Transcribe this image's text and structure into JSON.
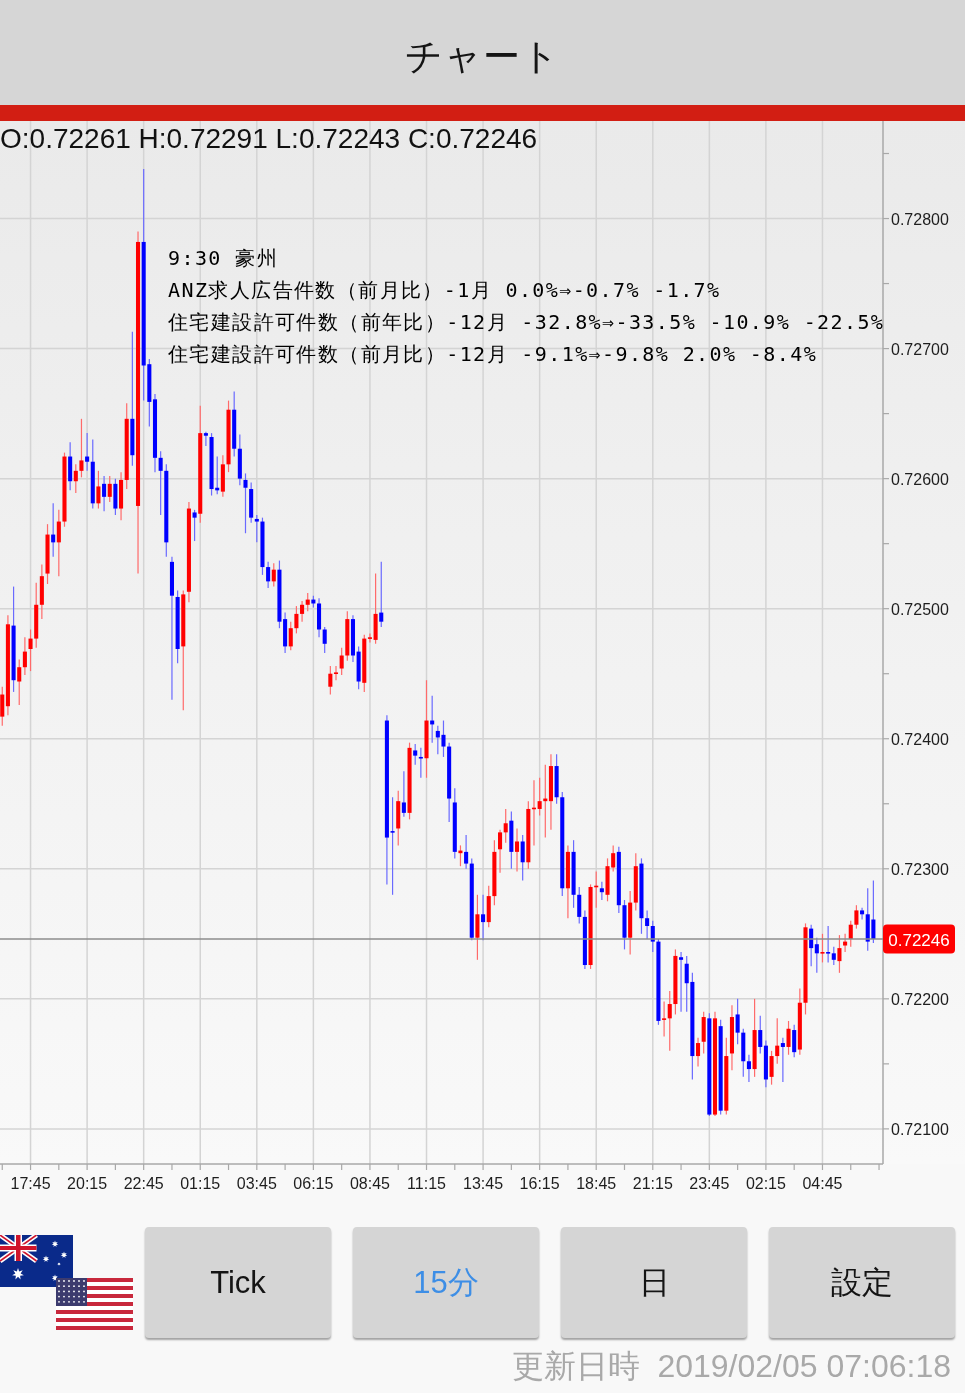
{
  "header": {
    "title": "チャート"
  },
  "chart": {
    "ohlc_readout": "O:0.72261 H:0.72291 L:0.72243 C:0.72246",
    "event_note": {
      "heading": "9:30 豪州",
      "lines": [
        "ANZ求人広告件数（前月比）-1月 0.0%⇒-0.7% -1.7%",
        "住宅建設許可件数（前年比）-12月 -32.8%⇒-33.5% -10.9% -22.5%",
        "住宅建設許可件数（前月比）-12月 -9.1%⇒-9.8% 2.0% -8.4%"
      ]
    },
    "chart_data": {
      "type": "candlestick",
      "grid": true,
      "categories": [
        null,
        null,
        null,
        null,
        null,
        "17:45",
        null,
        null,
        null,
        null,
        null,
        null,
        null,
        null,
        null,
        "20:15",
        null,
        null,
        null,
        null,
        null,
        null,
        null,
        null,
        null,
        "22:45",
        null,
        null,
        null,
        null,
        null,
        null,
        null,
        null,
        null,
        "01:15",
        null,
        null,
        null,
        null,
        null,
        null,
        null,
        null,
        null,
        "03:45",
        null,
        null,
        null,
        null,
        null,
        null,
        null,
        null,
        null,
        "06:15",
        null,
        null,
        null,
        null,
        null,
        null,
        null,
        null,
        null,
        "08:45",
        null,
        null,
        null,
        null,
        null,
        null,
        null,
        null,
        null,
        "11:15",
        null,
        null,
        null,
        null,
        null,
        null,
        null,
        null,
        null,
        "13:45",
        null,
        null,
        null,
        null,
        null,
        null,
        null,
        null,
        null,
        "16:15",
        null,
        null,
        null,
        null,
        null,
        null,
        null,
        null,
        null,
        "18:45",
        null,
        null,
        null,
        null,
        null,
        null,
        null,
        null,
        null,
        "21:15",
        null,
        null,
        null,
        null,
        null,
        null,
        null,
        null,
        null,
        "23:45",
        null,
        null,
        null,
        null,
        null,
        null,
        null,
        null,
        null,
        "02:15",
        null,
        null,
        null,
        null,
        null,
        null,
        null,
        null,
        null,
        "04:45",
        null,
        null,
        null,
        null,
        null,
        null,
        null,
        null,
        null
      ],
      "ohlc": [
        [
          0.72417,
          0.7244,
          0.7241,
          0.72434
        ],
        [
          0.72425,
          0.72495,
          0.72418,
          0.72488
        ],
        [
          0.72487,
          0.72517,
          0.72436,
          0.72445
        ],
        [
          0.72444,
          0.72461,
          0.72426,
          0.72455
        ],
        [
          0.72455,
          0.72478,
          0.72449,
          0.72467
        ],
        [
          0.72469,
          0.72484,
          0.72452,
          0.72477
        ],
        [
          0.72477,
          0.7252,
          0.7247,
          0.72503
        ],
        [
          0.72503,
          0.72534,
          0.72492,
          0.72525
        ],
        [
          0.72527,
          0.72565,
          0.72519,
          0.72557
        ],
        [
          0.72557,
          0.72581,
          0.7254,
          0.72551
        ],
        [
          0.72551,
          0.72576,
          0.72525,
          0.72567
        ],
        [
          0.72567,
          0.7262,
          0.72563,
          0.72617
        ],
        [
          0.72617,
          0.72628,
          0.72591,
          0.72598
        ],
        [
          0.72598,
          0.72611,
          0.72589,
          0.72606
        ],
        [
          0.72606,
          0.72646,
          0.72601,
          0.72614
        ],
        [
          0.72617,
          0.72635,
          0.72606,
          0.72613
        ],
        [
          0.72613,
          0.7263,
          0.72577,
          0.72581
        ],
        [
          0.72581,
          0.72606,
          0.72577,
          0.72594
        ],
        [
          0.72596,
          0.72602,
          0.72575,
          0.72586
        ],
        [
          0.72586,
          0.72602,
          0.72582,
          0.72596
        ],
        [
          0.72596,
          0.726,
          0.72572,
          0.72577
        ],
        [
          0.72577,
          0.72605,
          0.72568,
          0.72599
        ],
        [
          0.72599,
          0.72658,
          0.72592,
          0.72646
        ],
        [
          0.72646,
          0.72713,
          0.7261,
          0.72618
        ],
        [
          0.72579,
          0.7279,
          0.72527,
          0.72782
        ],
        [
          0.72782,
          0.72838,
          0.7266,
          0.72687
        ],
        [
          0.72688,
          0.72692,
          0.7264,
          0.72659
        ],
        [
          0.72661,
          0.72665,
          0.72605,
          0.72616
        ],
        [
          0.72616,
          0.72621,
          0.72572,
          0.72606
        ],
        [
          0.72606,
          0.72611,
          0.7254,
          0.72551
        ],
        [
          0.72536,
          0.7254,
          0.7243,
          0.7251
        ],
        [
          0.72509,
          0.72514,
          0.72458,
          0.72469
        ],
        [
          0.72471,
          0.72514,
          0.72422,
          0.72511
        ],
        [
          0.72513,
          0.72582,
          0.72505,
          0.72577
        ],
        [
          0.72574,
          0.72576,
          0.72552,
          0.7257
        ],
        [
          0.72573,
          0.72656,
          0.72566,
          0.72635
        ],
        [
          0.72635,
          0.72636,
          0.72625,
          0.72633
        ],
        [
          0.72632,
          0.72635,
          0.72587,
          0.72592
        ],
        [
          0.72593,
          0.72617,
          0.72588,
          0.72591
        ],
        [
          0.7259,
          0.72618,
          0.72586,
          0.72611
        ],
        [
          0.72611,
          0.7266,
          0.72605,
          0.72653
        ],
        [
          0.72653,
          0.72667,
          0.72617,
          0.72623
        ],
        [
          0.72623,
          0.72634,
          0.72595,
          0.726
        ],
        [
          0.72599,
          0.72604,
          0.72558,
          0.72593
        ],
        [
          0.72592,
          0.72597,
          0.72566,
          0.7257
        ],
        [
          0.72569,
          0.72572,
          0.72551,
          0.72567
        ],
        [
          0.72567,
          0.7257,
          0.72526,
          0.72532
        ],
        [
          0.72532,
          0.72536,
          0.72516,
          0.72521
        ],
        [
          0.72521,
          0.72535,
          0.72517,
          0.7253
        ],
        [
          0.7253,
          0.72537,
          0.72485,
          0.7249
        ],
        [
          0.72492,
          0.72497,
          0.72466,
          0.72471
        ],
        [
          0.72471,
          0.7249,
          0.72468,
          0.72485
        ],
        [
          0.72485,
          0.72502,
          0.72481,
          0.72496
        ],
        [
          0.72496,
          0.72506,
          0.7249,
          0.72503
        ],
        [
          0.72503,
          0.72512,
          0.72498,
          0.72507
        ],
        [
          0.72507,
          0.7251,
          0.72501,
          0.72504
        ],
        [
          0.72504,
          0.72508,
          0.72478,
          0.72484
        ],
        [
          0.72484,
          0.72486,
          0.72466,
          0.72473
        ],
        [
          0.7244,
          0.72456,
          0.72434,
          0.7245
        ],
        [
          0.7245,
          0.72456,
          0.72445,
          0.72451
        ],
        [
          0.72454,
          0.7247,
          0.72449,
          0.72464
        ],
        [
          0.72464,
          0.72498,
          0.7246,
          0.72492
        ],
        [
          0.72492,
          0.72495,
          0.72459,
          0.72464
        ],
        [
          0.72467,
          0.72471,
          0.72438,
          0.72444
        ],
        [
          0.72443,
          0.7248,
          0.72436,
          0.72477
        ],
        [
          0.72477,
          0.72481,
          0.72474,
          0.72478
        ],
        [
          0.72476,
          0.72527,
          0.72473,
          0.72496
        ],
        [
          0.72497,
          0.72536,
          0.72486,
          0.7249
        ],
        [
          0.72414,
          0.72418,
          0.72288,
          0.72324
        ],
        [
          0.72329,
          0.72355,
          0.7228,
          0.72328
        ],
        [
          0.72331,
          0.7236,
          0.72318,
          0.72352
        ],
        [
          0.72351,
          0.72375,
          0.7234,
          0.72343
        ],
        [
          0.72343,
          0.72397,
          0.72338,
          0.72393
        ],
        [
          0.72391,
          0.72396,
          0.7238,
          0.72387
        ],
        [
          0.72386,
          0.72393,
          0.7237,
          0.72385
        ],
        [
          0.72385,
          0.72445,
          0.7237,
          0.72414
        ],
        [
          0.72414,
          0.72433,
          0.72397,
          0.72411
        ],
        [
          0.72406,
          0.7241,
          0.72388,
          0.72401
        ],
        [
          0.72403,
          0.72414,
          0.72386,
          0.72394
        ],
        [
          0.72394,
          0.72397,
          0.72336,
          0.72354
        ],
        [
          0.72351,
          0.72362,
          0.72308,
          0.72313
        ],
        [
          0.72312,
          0.72318,
          0.72302,
          0.72314
        ],
        [
          0.72313,
          0.72326,
          0.723,
          0.72304
        ],
        [
          0.72304,
          0.72308,
          0.72245,
          0.72247
        ],
        [
          0.72247,
          0.7228,
          0.7223,
          0.72265
        ],
        [
          0.72265,
          0.7228,
          0.72245,
          0.72259
        ],
        [
          0.72259,
          0.72287,
          0.72255,
          0.72279
        ],
        [
          0.72279,
          0.72322,
          0.72272,
          0.72313
        ],
        [
          0.72315,
          0.7233,
          0.72297,
          0.72328
        ],
        [
          0.72328,
          0.72346,
          0.7232,
          0.72335
        ],
        [
          0.72337,
          0.72344,
          0.723,
          0.72313
        ],
        [
          0.72313,
          0.72331,
          0.72298,
          0.72321
        ],
        [
          0.72321,
          0.72326,
          0.72291,
          0.72305
        ],
        [
          0.72305,
          0.72352,
          0.723,
          0.72346
        ],
        [
          0.72346,
          0.72368,
          0.72318,
          0.72347
        ],
        [
          0.72346,
          0.7237,
          0.72341,
          0.72352
        ],
        [
          0.72352,
          0.7238,
          0.72324,
          0.72354
        ],
        [
          0.72352,
          0.72388,
          0.7233,
          0.72379
        ],
        [
          0.72379,
          0.72388,
          0.7235,
          0.72355
        ],
        [
          0.72355,
          0.72359,
          0.72279,
          0.72285
        ],
        [
          0.72285,
          0.72318,
          0.72262,
          0.72313
        ],
        [
          0.72313,
          0.72322,
          0.7227,
          0.7228
        ],
        [
          0.7228,
          0.72286,
          0.72258,
          0.72263
        ],
        [
          0.72263,
          0.72268,
          0.72223,
          0.72226
        ],
        [
          0.72226,
          0.72288,
          0.72223,
          0.72286
        ],
        [
          0.72286,
          0.72298,
          0.7227,
          0.72287
        ],
        [
          0.72285,
          0.7229,
          0.72276,
          0.72282
        ],
        [
          0.7228,
          0.72308,
          0.72275,
          0.72302
        ],
        [
          0.72301,
          0.72318,
          0.72298,
          0.72312
        ],
        [
          0.72313,
          0.72317,
          0.72266,
          0.72272
        ],
        [
          0.72272,
          0.72276,
          0.72238,
          0.72247
        ],
        [
          0.72247,
          0.72283,
          0.72234,
          0.72274
        ],
        [
          0.72274,
          0.72312,
          0.72268,
          0.72302
        ],
        [
          0.72304,
          0.72308,
          0.7225,
          0.72262
        ],
        [
          0.72262,
          0.72268,
          0.72246,
          0.72256
        ],
        [
          0.72256,
          0.7226,
          0.72236,
          0.72244
        ],
        [
          0.72244,
          0.72246,
          0.7218,
          0.72183
        ],
        [
          0.72184,
          0.72198,
          0.72171,
          0.72185
        ],
        [
          0.72185,
          0.72206,
          0.7216,
          0.72196
        ],
        [
          0.72196,
          0.72238,
          0.72188,
          0.72233
        ],
        [
          0.72232,
          0.72236,
          0.7219,
          0.7223
        ],
        [
          0.72227,
          0.72233,
          0.7219,
          0.72212
        ],
        [
          0.72213,
          0.7222,
          0.72138,
          0.72156
        ],
        [
          0.72156,
          0.7217,
          0.72148,
          0.72166
        ],
        [
          0.72167,
          0.7219,
          0.72158,
          0.72186
        ],
        [
          0.72185,
          0.72189,
          0.7211,
          0.72111
        ],
        [
          0.72111,
          0.7219,
          0.7211,
          0.72185
        ],
        [
          0.72179,
          0.72184,
          0.72111,
          0.72114
        ],
        [
          0.72114,
          0.7217,
          0.72111,
          0.72156
        ],
        [
          0.72158,
          0.72195,
          0.72145,
          0.72186
        ],
        [
          0.72188,
          0.722,
          0.72165,
          0.72174
        ],
        [
          0.72174,
          0.72177,
          0.7214,
          0.72152
        ],
        [
          0.72152,
          0.72157,
          0.72136,
          0.72146
        ],
        [
          0.72146,
          0.722,
          0.7214,
          0.72176
        ],
        [
          0.72176,
          0.72187,
          0.72158,
          0.72163
        ],
        [
          0.72164,
          0.72168,
          0.72132,
          0.72138
        ],
        [
          0.7214,
          0.7216,
          0.72134,
          0.72156
        ],
        [
          0.72156,
          0.72185,
          0.7215,
          0.72164
        ],
        [
          0.72166,
          0.7217,
          0.72136,
          0.72163
        ],
        [
          0.72163,
          0.72183,
          0.72157,
          0.72177
        ],
        [
          0.72176,
          0.7218,
          0.72155,
          0.72159
        ],
        [
          0.72161,
          0.72208,
          0.72157,
          0.72197
        ],
        [
          0.72197,
          0.72258,
          0.72188,
          0.72255
        ],
        [
          0.72254,
          0.72257,
          0.72225,
          0.72239
        ],
        [
          0.72242,
          0.72247,
          0.7222,
          0.72235
        ],
        [
          0.72235,
          0.7225,
          0.72228,
          0.72236
        ],
        [
          0.72236,
          0.72256,
          0.72228,
          0.72235
        ],
        [
          0.72235,
          0.7224,
          0.72226,
          0.7223
        ],
        [
          0.72229,
          0.72249,
          0.7222,
          0.72239
        ],
        [
          0.72241,
          0.7225,
          0.72236,
          0.72244
        ],
        [
          0.72246,
          0.7226,
          0.7224,
          0.72257
        ],
        [
          0.72257,
          0.72272,
          0.72254,
          0.72268
        ],
        [
          0.72268,
          0.7227,
          0.72261,
          0.72265
        ],
        [
          0.72265,
          0.72285,
          0.72237,
          0.72244
        ],
        [
          0.72261,
          0.72291,
          0.72243,
          0.72246
        ]
      ],
      "ylim": [
        0.72073,
        0.72875
      ],
      "yticks": [
        {
          "value": 0.728,
          "label": "0.72800"
        },
        {
          "value": 0.727,
          "label": "0.72700"
        },
        {
          "value": 0.726,
          "label": "0.72600"
        },
        {
          "value": 0.725,
          "label": "0.72500"
        },
        {
          "value": 0.724,
          "label": "0.72400"
        },
        {
          "value": 0.723,
          "label": "0.72300"
        },
        {
          "value": 0.722,
          "label": "0.72200"
        },
        {
          "value": 0.721,
          "label": "0.72100"
        }
      ],
      "ref_lines": [
        {
          "axis": "y",
          "value": 0.72246,
          "label": "0.72246"
        }
      ]
    }
  },
  "timeframes": [
    {
      "label": "Tick",
      "selected": false
    },
    {
      "label": "15分",
      "selected": true
    },
    {
      "label": "日",
      "selected": false
    }
  ],
  "settings_button": {
    "label": "設定"
  },
  "updated": {
    "label": "更新日時",
    "value": "2019/02/05 07:06:18"
  }
}
